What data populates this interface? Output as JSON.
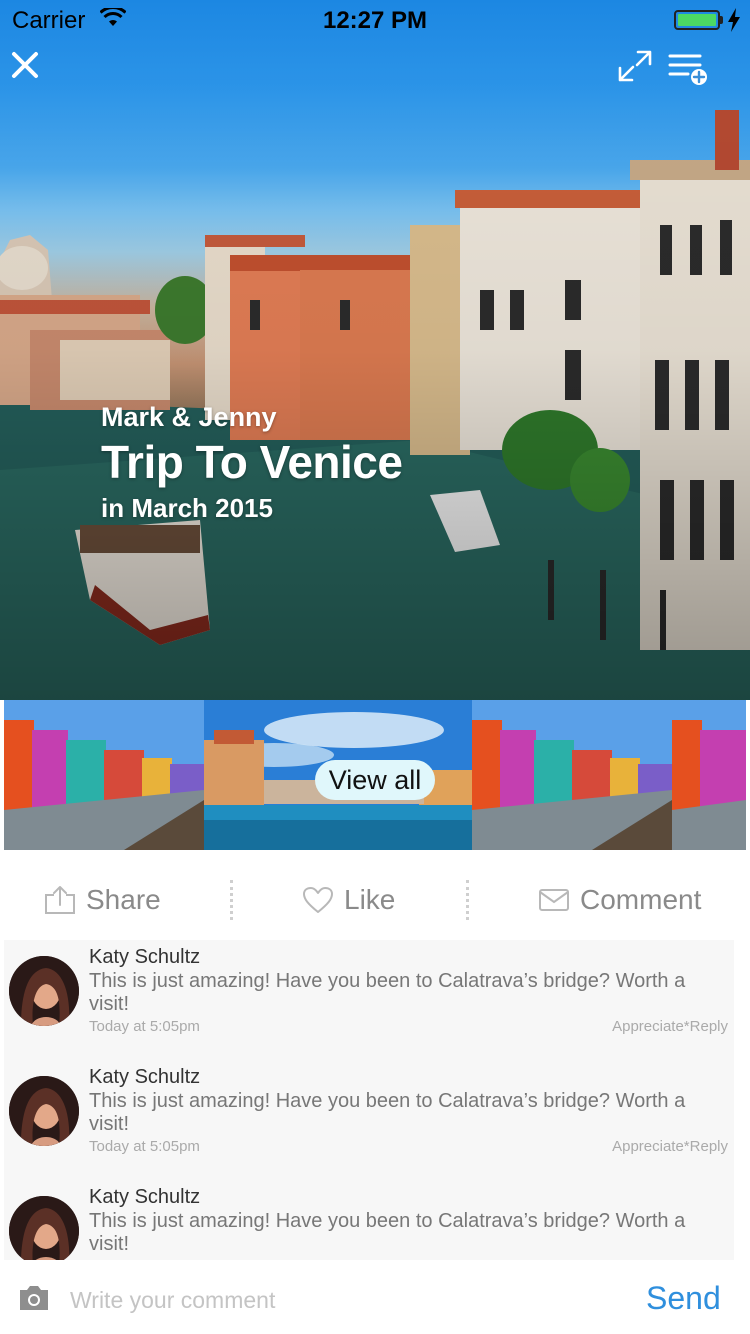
{
  "status_bar": {
    "carrier": "Carrier",
    "time": "12:27 PM",
    "battery_level": 1.0,
    "battery_color": "#4cd964"
  },
  "header": {
    "close_icon": "close-icon",
    "expand_icon": "expand-icon",
    "playlist_icon": "playlist-add-icon"
  },
  "hero": {
    "names": "Mark & Jenny",
    "title": "Trip To Venice",
    "date": "in March 2015"
  },
  "gallery": {
    "view_all_label": "View all"
  },
  "actions": {
    "share_label": "Share",
    "like_label": "Like",
    "comment_label": "Comment",
    "share_icon": "share-icon",
    "like_icon": "heart-icon",
    "comment_icon": "envelope-icon"
  },
  "comments": [
    {
      "author": "Katy Schultz",
      "text": "This is just amazing! Have you been to Calatrava’s bridge? Worth a visit!",
      "time": "Today at 5:05pm",
      "actions": "Appreciate*Reply"
    },
    {
      "author": "Katy Schultz",
      "text": "This is just amazing! Have you been to Calatrava’s bridge? Worth a visit!",
      "time": "Today at 5:05pm",
      "actions": "Appreciate*Reply"
    },
    {
      "author": "Katy Schultz",
      "text": "This is just amazing! Have you been to Calatrava’s bridge? Worth a visit!",
      "time": "",
      "actions": ""
    }
  ],
  "composer": {
    "placeholder": "Write your comment",
    "send_label": "Send",
    "camera_icon": "camera-icon"
  },
  "colors": {
    "accent": "#2f8fdd",
    "sky": "#1c87e2",
    "view_all_bg": "#e0f7fb"
  }
}
